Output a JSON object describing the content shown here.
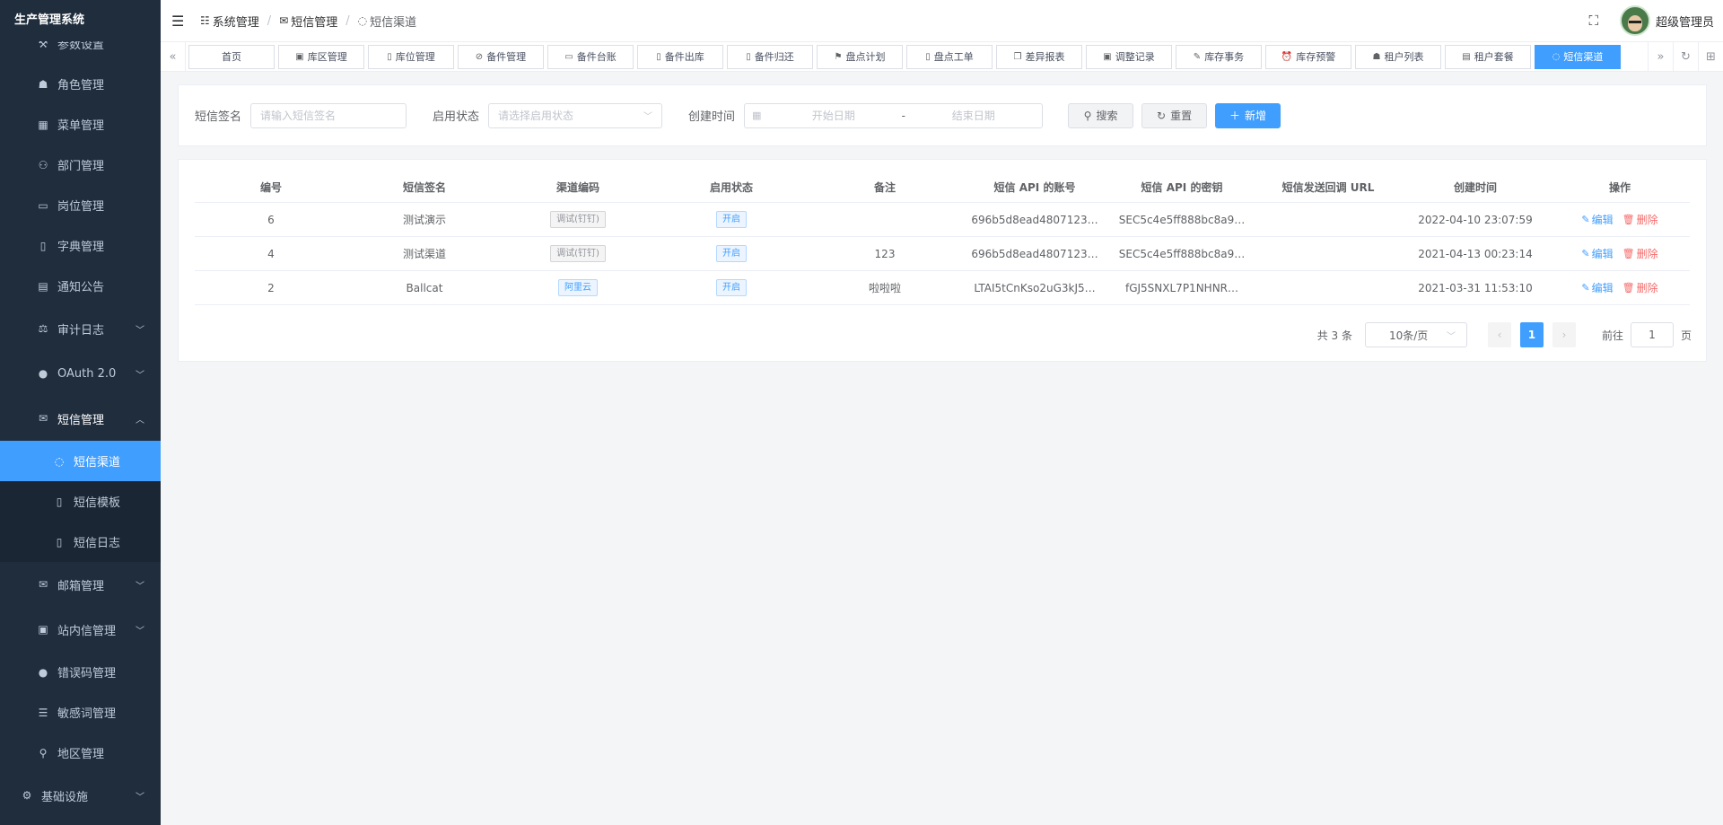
{
  "app": {
    "title": "生产管理系统"
  },
  "sidebar": {
    "items": [
      {
        "label": "参数设置",
        "icon": "wrench-icon"
      },
      {
        "label": "角色管理",
        "icon": "users-icon"
      },
      {
        "label": "菜单管理",
        "icon": "grid-icon"
      },
      {
        "label": "部门管理",
        "icon": "org-icon"
      },
      {
        "label": "岗位管理",
        "icon": "idcard-icon"
      },
      {
        "label": "字典管理",
        "icon": "book-icon"
      },
      {
        "label": "通知公告",
        "icon": "notice-icon"
      },
      {
        "label": "审计日志",
        "icon": "audit-icon"
      },
      {
        "label": "OAuth 2.0",
        "icon": "user-icon"
      },
      {
        "label": "短信管理",
        "icon": "mail-icon"
      },
      {
        "label": "短信渠道",
        "icon": "chat-icon"
      },
      {
        "label": "短信模板",
        "icon": "doc-icon"
      },
      {
        "label": "短信日志",
        "icon": "doc-icon"
      },
      {
        "label": "邮箱管理",
        "icon": "envelope-icon"
      },
      {
        "label": "站内信管理",
        "icon": "inbox-icon"
      },
      {
        "label": "错误码管理",
        "icon": "error-icon"
      },
      {
        "label": "敏感词管理",
        "icon": "list-icon"
      },
      {
        "label": "地区管理",
        "icon": "location-icon"
      },
      {
        "label": "基础设施",
        "icon": "gear-icon"
      }
    ]
  },
  "header": {
    "breadcrumb": [
      "系统管理",
      "短信管理",
      "短信渠道"
    ],
    "username": "超级管理员"
  },
  "tags": [
    "首页",
    "库区管理",
    "库位管理",
    "备件管理",
    "备件台账",
    "备件出库",
    "备件归还",
    "盘点计划",
    "盘点工单",
    "差异报表",
    "调整记录",
    "库存事务",
    "库存预警",
    "租户列表",
    "租户套餐",
    "短信渠道"
  ],
  "search": {
    "sign_label": "短信签名",
    "sign_placeholder": "请输入短信签名",
    "status_label": "启用状态",
    "status_placeholder": "请选择启用状态",
    "time_label": "创建时间",
    "start_placeholder": "开始日期",
    "range_sep": "-",
    "end_placeholder": "结束日期",
    "search_btn": "搜索",
    "reset_btn": "重置",
    "add_btn": "新增"
  },
  "table": {
    "columns": [
      "编号",
      "短信签名",
      "渠道编码",
      "启用状态",
      "备注",
      "短信 API 的账号",
      "短信 API 的密钥",
      "短信发送回调 URL",
      "创建时间",
      "操作"
    ],
    "rows": [
      {
        "id": "6",
        "sign": "测试演示",
        "code": "调试(钉钉)",
        "status": "开启",
        "remark": "",
        "account": "696b5d8ead4807123…",
        "secret": "SEC5c4e5ff888bc8a9…",
        "callback": "",
        "created": "2022-04-10 23:07:59"
      },
      {
        "id": "4",
        "sign": "测试渠道",
        "code": "调试(钉钉)",
        "status": "开启",
        "remark": "123",
        "account": "696b5d8ead4807123…",
        "secret": "SEC5c4e5ff888bc8a9…",
        "callback": "",
        "created": "2021-04-13 00:23:14"
      },
      {
        "id": "2",
        "sign": "Ballcat",
        "code": "阿里云",
        "status": "开启",
        "remark": "啦啦啦",
        "account": "LTAI5tCnKso2uG3kJ5…",
        "secret": "fGJ5SNXL7P1NHNR…",
        "callback": "",
        "created": "2021-03-31 11:53:10"
      }
    ],
    "edit_label": "编辑",
    "delete_label": "删除"
  },
  "pagination": {
    "total": "共 3 条",
    "page_size": "10条/页",
    "current": "1",
    "goto_label": "前往",
    "goto_value": "1",
    "page_suffix": "页"
  },
  "colors": {
    "sidebar_bg": "#1f2d3d",
    "accent": "#409eff",
    "danger": "#f56c6c"
  }
}
